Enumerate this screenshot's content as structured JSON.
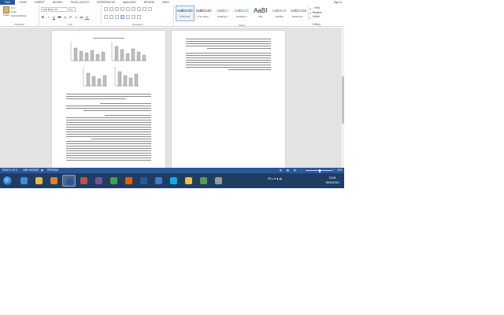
{
  "ribbon_tabs": [
    "FILE",
    "HOME",
    "INSERT",
    "DESIGN",
    "PAGE LAYOUT",
    "REFERENCES",
    "MAILINGS",
    "REVIEW",
    "VIEW"
  ],
  "active_tab": "HOME",
  "signin": "Sign in",
  "clipboard": {
    "paste": "Paste",
    "cut": "Cut",
    "copy": "Copy",
    "format_painter": "Format Painter",
    "label": "Clipboard"
  },
  "font": {
    "name": "Arial Body CS",
    "size": "11",
    "label": "Font"
  },
  "paragraph_label": "Paragraph",
  "styles": [
    {
      "preview": "AaBbCcDc",
      "name": "¶ Normal"
    },
    {
      "preview": "AaBbCcDc",
      "name": "¶ No Spac..."
    },
    {
      "preview": "AaBbCc",
      "name": "Heading 1"
    },
    {
      "preview": "AaBbCcC",
      "name": "Heading 2"
    },
    {
      "preview": "AaBI",
      "name": "Title"
    },
    {
      "preview": "AaBbCcC",
      "name": "Subtitle"
    },
    {
      "preview": "AaBbCcDd",
      "name": "Subtle Em..."
    }
  ],
  "styles_label": "Styles",
  "editing": {
    "find": "Find",
    "replace": "Replace",
    "select": "Select",
    "label": "Editing"
  },
  "status": {
    "page": "PAGE 1 OF 3",
    "words": "1692 WORDS",
    "language": "PERSIAN",
    "zoom": "40%"
  },
  "zoom_fraction": 0.5,
  "tray": {
    "language": "EN"
  },
  "clock": {
    "time": "15:08",
    "date": "05/06/2016"
  },
  "taskbar_apps": [
    {
      "name": "ie-icon",
      "color": "#3a8ed8"
    },
    {
      "name": "folder-icon",
      "color": "#e8b64a"
    },
    {
      "name": "media-icon",
      "color": "#e47d2a"
    },
    {
      "name": "word-icon",
      "color": "#2b579a"
    },
    {
      "name": "calendar-icon",
      "color": "#c0504d"
    },
    {
      "name": "viber-icon",
      "color": "#7b519d"
    },
    {
      "name": "chrome-icon",
      "color": "#4a9e47"
    },
    {
      "name": "firefox-icon",
      "color": "#e66000"
    },
    {
      "name": "word-doc-icon",
      "color": "#2b579a"
    },
    {
      "name": "network-icon",
      "color": "#3d7cc9"
    },
    {
      "name": "skype-icon",
      "color": "#00aff0"
    },
    {
      "name": "explorer-icon",
      "color": "#e3c24b"
    },
    {
      "name": "chart-app-icon",
      "color": "#5a9a4a"
    },
    {
      "name": "tools-icon",
      "color": "#9a9a9a"
    }
  ]
}
